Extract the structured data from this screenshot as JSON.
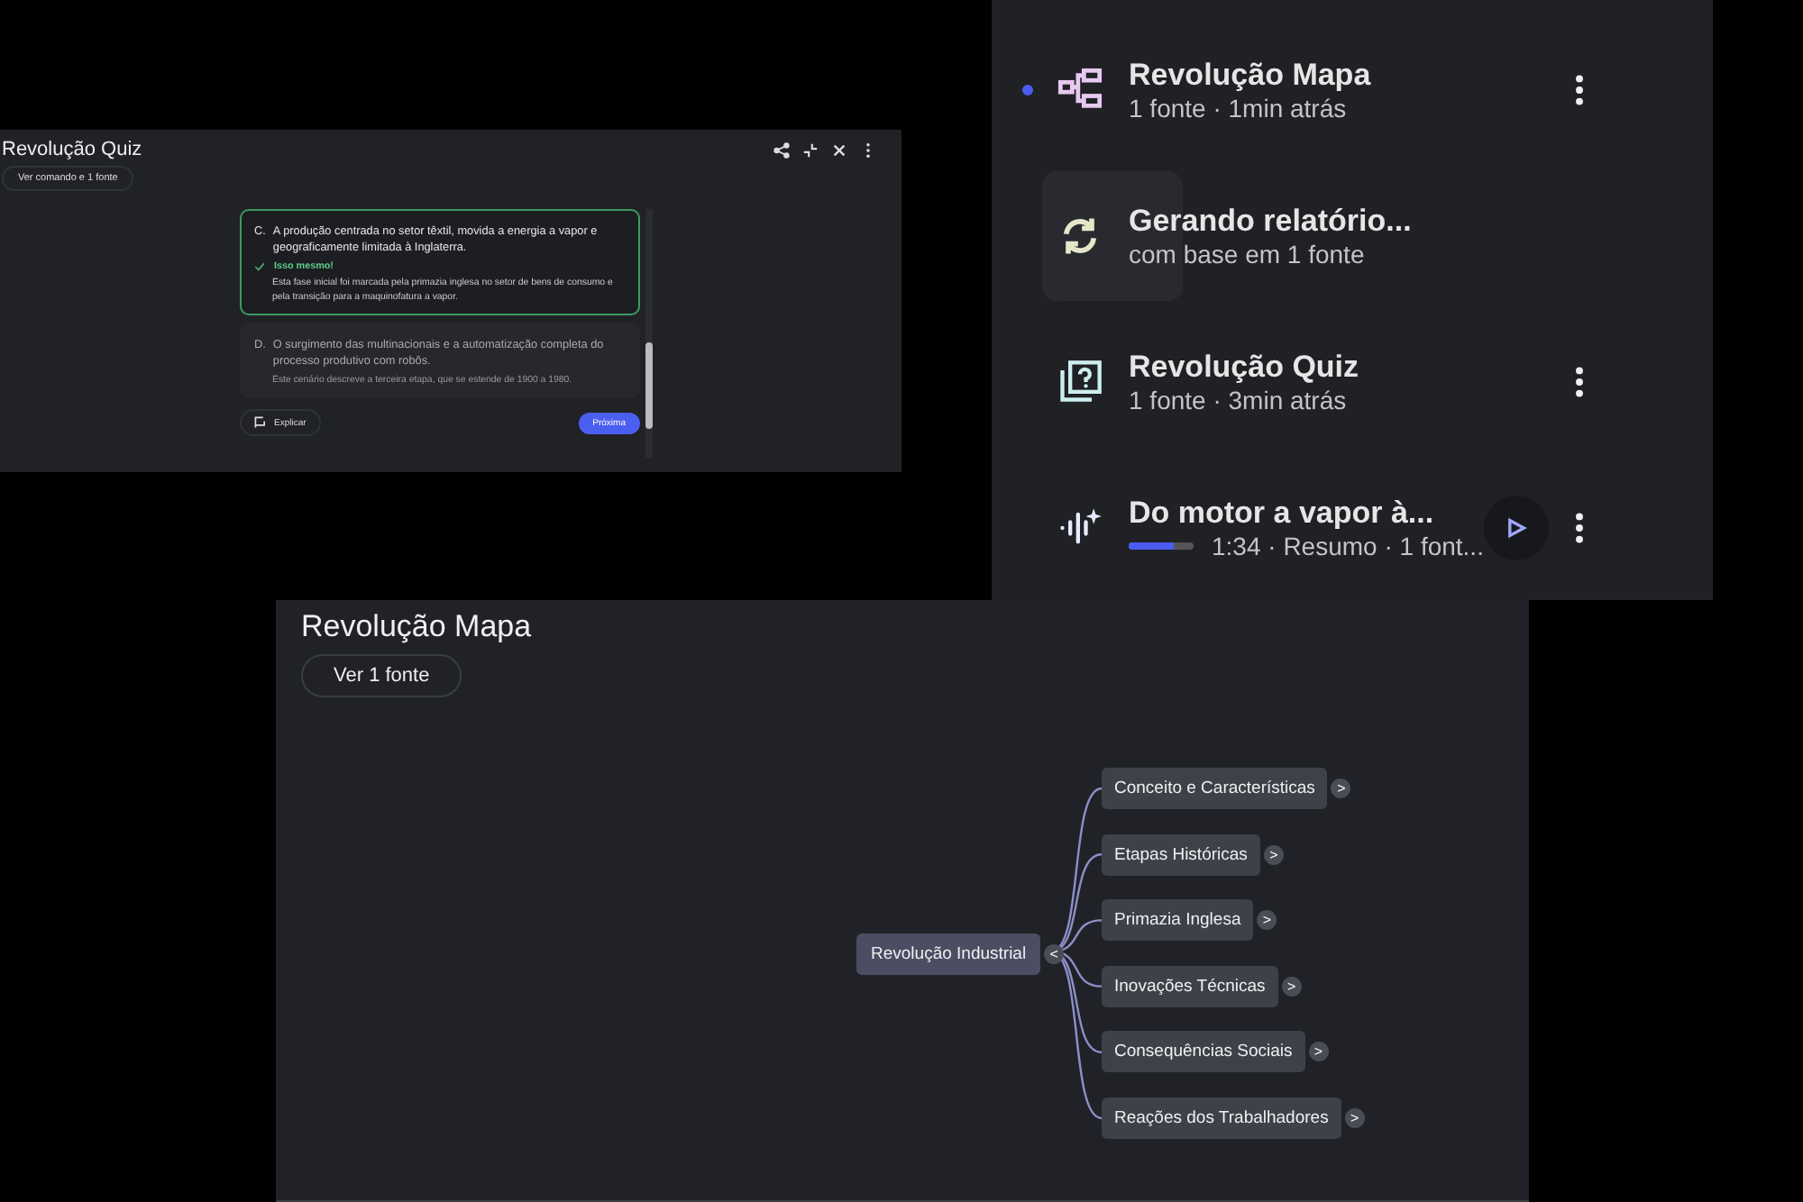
{
  "quiz_window": {
    "title": "Revolução Quiz",
    "source_button": "Ver comando e 1 fonte",
    "options": [
      {
        "letter": "C.",
        "text": "A produção centrada no setor têxtil, movida a energia a vapor e geograficamente limitada à Inglaterra.",
        "kind": "correct",
        "feedback": "Isso mesmo!",
        "explanation": "Esta fase inicial foi marcada pela primazia inglesa no setor de bens de consumo e pela transição para a maquinofatura a vapor."
      },
      {
        "letter": "D.",
        "text": "O surgimento das multinacionais e a automatização completa do processo produtivo com robôs.",
        "kind": "dimmed",
        "explanation": "Este cenário descreve a terceira etapa, que se estende de 1900 a 1980."
      }
    ],
    "explain_button": "Explicar",
    "next_button": "Próxima"
  },
  "studio_list": {
    "items": [
      {
        "kind": "mind_map",
        "title": "Revolução Mapa",
        "subtitle": "1 fonte · 1min atrás",
        "unread": true
      },
      {
        "kind": "generating",
        "title": "Gerando relatório...",
        "subtitle": "com base em 1 fonte",
        "unread": false
      },
      {
        "kind": "quiz",
        "title": "Revolução Quiz",
        "subtitle": "1 fonte · 3min atrás",
        "unread": false
      },
      {
        "kind": "audio",
        "title": "Do motor a vapor à...",
        "subtitle": "1:34 · Resumo · 1 font...",
        "unread": false,
        "level": 0.7
      }
    ]
  },
  "mind_map_window": {
    "title": "Revolução Mapa",
    "source_button": "Ver 1 fonte",
    "root": {
      "label": "Revolução Industrial",
      "toggle": "<",
      "children": [
        {
          "label": "Conceito e Características",
          "toggle": ">"
        },
        {
          "label": "Etapas Históricas",
          "toggle": ">"
        },
        {
          "label": "Primazia Inglesa",
          "toggle": ">"
        },
        {
          "label": "Inovações Técnicas",
          "toggle": ">"
        },
        {
          "label": "Consequências Sociais",
          "toggle": ">"
        },
        {
          "label": "Reações dos Trabalhadores",
          "toggle": ">"
        }
      ]
    }
  }
}
